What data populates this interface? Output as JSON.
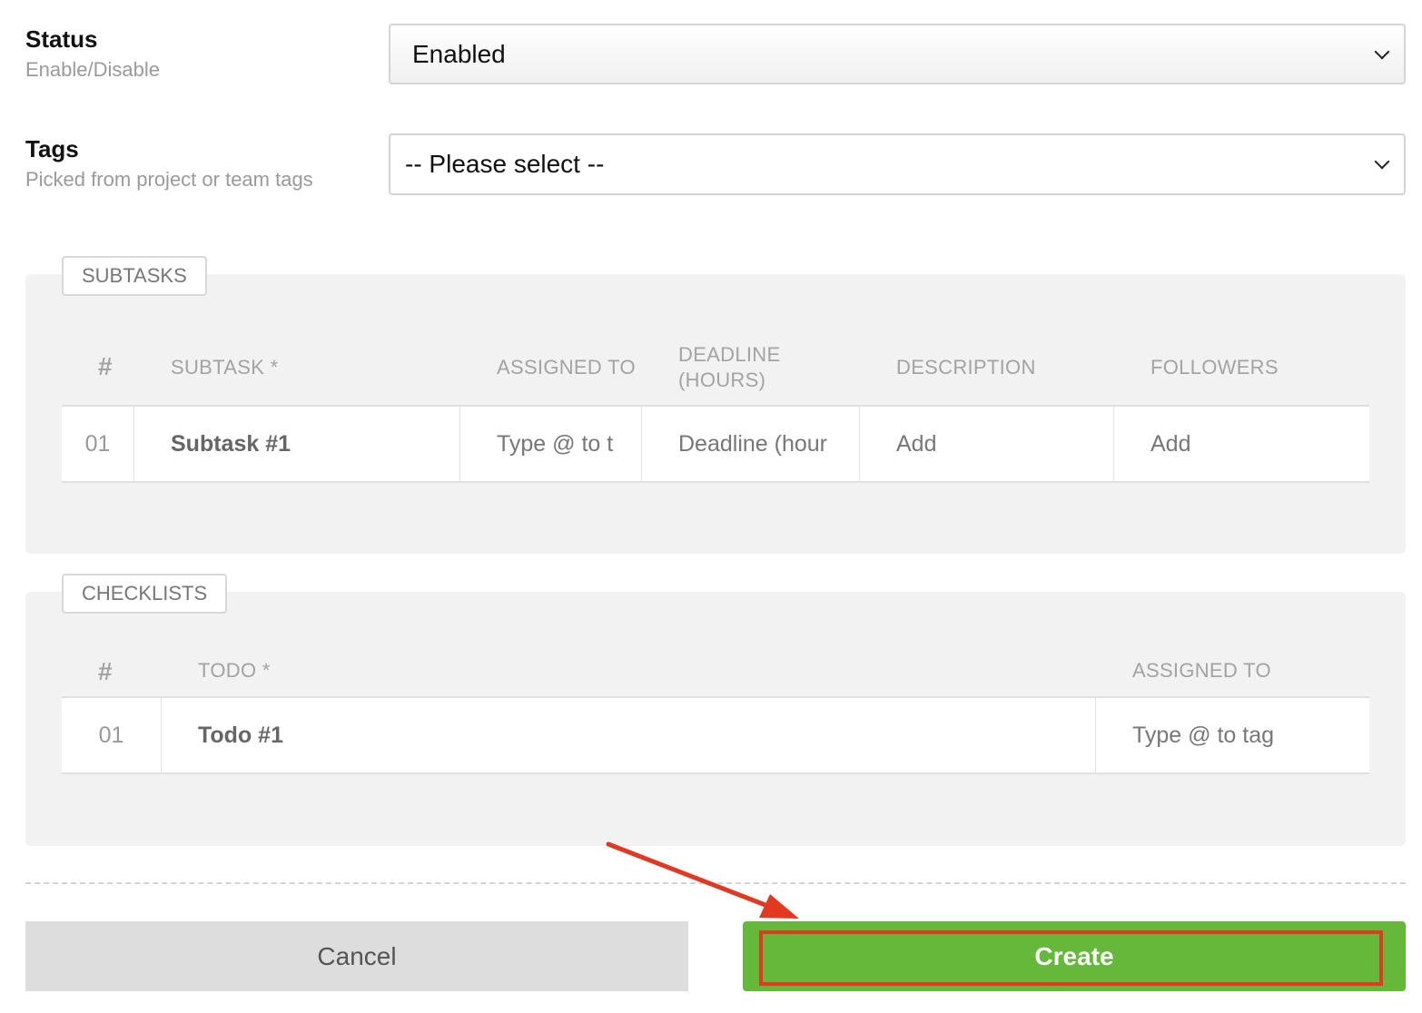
{
  "form": {
    "status": {
      "title": "Status",
      "hint": "Enable/Disable",
      "value": "Enabled"
    },
    "tags": {
      "title": "Tags",
      "hint": "Picked from project or team tags",
      "value": "-- Please select --"
    }
  },
  "subtasks": {
    "legend": "SUBTASKS",
    "headers": {
      "num": "#",
      "subtask": "SUBTASK *",
      "assigned": "ASSIGNED TO",
      "deadline_1": "DEADLINE",
      "deadline_2": "(HOURS)",
      "description": "DESCRIPTION",
      "followers": "FOLLOWERS"
    },
    "rows": [
      {
        "num": "01",
        "subtask": "Subtask #1",
        "assigned_placeholder": "Type @ to t",
        "deadline_placeholder": "Deadline (hour",
        "description": "Add",
        "followers": "Add"
      }
    ]
  },
  "checklists": {
    "legend": "CHECKLISTS",
    "headers": {
      "num": "#",
      "todo": "TODO *",
      "assigned": "ASSIGNED TO"
    },
    "rows": [
      {
        "num": "01",
        "todo": "Todo #1",
        "assigned_placeholder": "Type @ to tag"
      }
    ]
  },
  "actions": {
    "cancel": "Cancel",
    "create": "Create"
  },
  "annotation": {
    "highlight_color": "#e03a23",
    "create_color": "#64b83a"
  }
}
